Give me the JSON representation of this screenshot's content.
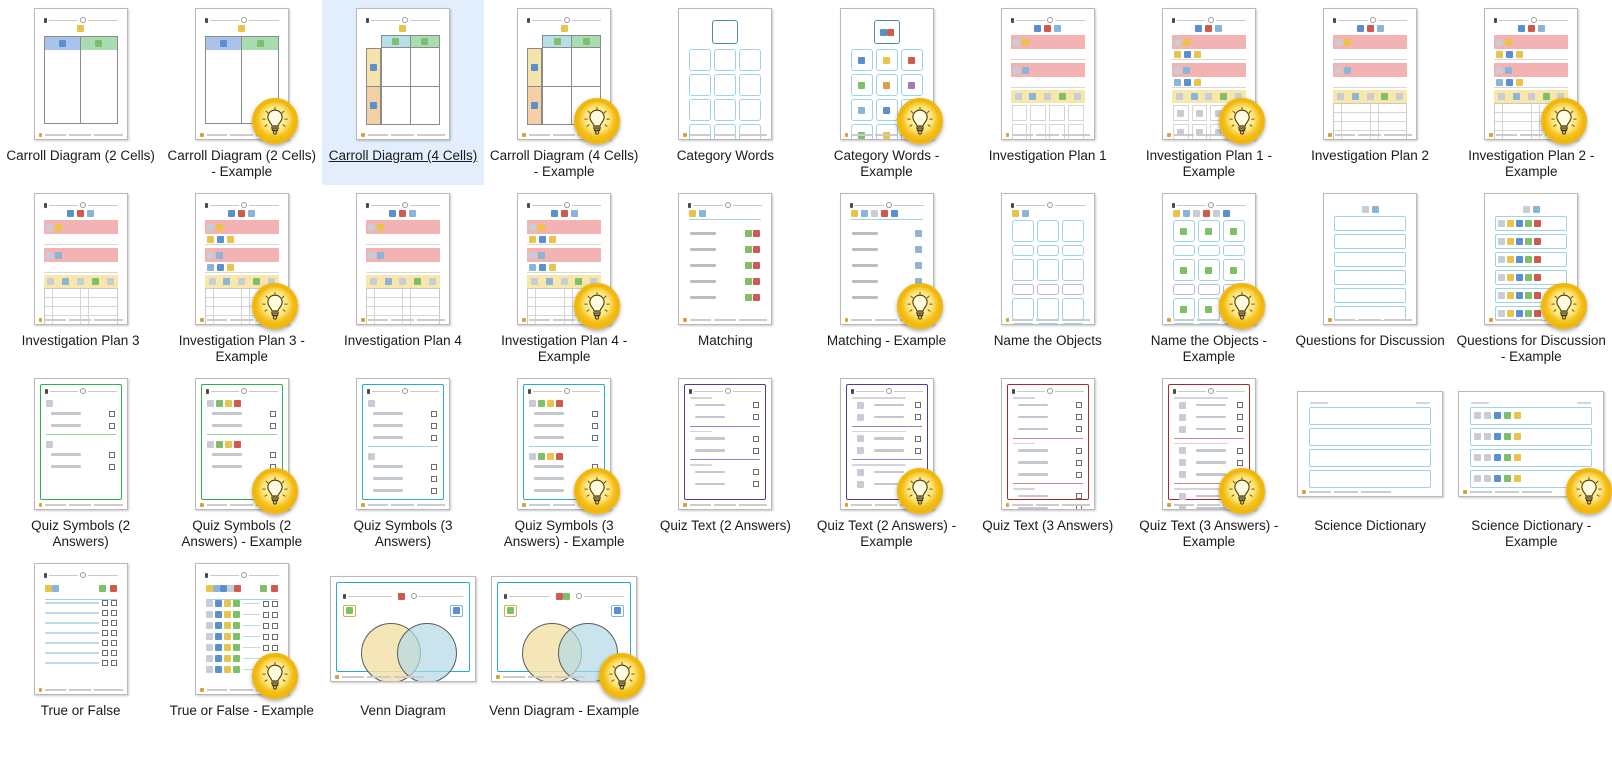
{
  "window": {
    "background": "#ffffff",
    "selection_color": "#e2eefc",
    "badge_color": "#f2b70d"
  },
  "grid": {
    "columns": 10,
    "rows": 4,
    "item_count": 34
  },
  "items": [
    {
      "label": "Carroll Diagram (2 Cells)",
      "kind": "carroll2",
      "example": false,
      "selected": false,
      "orientation": "portrait",
      "border": "none"
    },
    {
      "label": "Carroll Diagram (2 Cells) - Example",
      "kind": "carroll2ex",
      "example": true,
      "selected": false,
      "orientation": "portrait",
      "border": "none"
    },
    {
      "label": "Carroll Diagram (4 Cells)",
      "kind": "carroll4",
      "example": false,
      "selected": true,
      "orientation": "portrait",
      "border": "none"
    },
    {
      "label": "Carroll Diagram (4 Cells) - Example",
      "kind": "carroll4",
      "example": true,
      "selected": false,
      "orientation": "portrait",
      "border": "none"
    },
    {
      "label": "Category Words",
      "kind": "category",
      "example": false,
      "selected": false,
      "orientation": "portrait",
      "border": "none"
    },
    {
      "label": "Category Words - Example",
      "kind": "categoryex",
      "example": true,
      "selected": false,
      "orientation": "portrait",
      "border": "none"
    },
    {
      "label": "Investigation Plan 1",
      "kind": "plan1",
      "example": false,
      "selected": false,
      "orientation": "portrait",
      "border": "none"
    },
    {
      "label": "Investigation Plan 1 - Example",
      "kind": "plan1ex",
      "example": true,
      "selected": false,
      "orientation": "portrait",
      "border": "none"
    },
    {
      "label": "Investigation Plan 2",
      "kind": "plan2",
      "example": false,
      "selected": false,
      "orientation": "portrait",
      "border": "none"
    },
    {
      "label": "Investigation Plan 2 - Example",
      "kind": "plan2ex",
      "example": true,
      "selected": false,
      "orientation": "portrait",
      "border": "none"
    },
    {
      "label": "Investigation Plan 3",
      "kind": "plan2",
      "example": false,
      "selected": false,
      "orientation": "portrait",
      "border": "none"
    },
    {
      "label": "Investigation Plan 3 - Example",
      "kind": "plan2ex",
      "example": true,
      "selected": false,
      "orientation": "portrait",
      "border": "none"
    },
    {
      "label": "Investigation Plan 4",
      "kind": "plan2",
      "example": false,
      "selected": false,
      "orientation": "portrait",
      "border": "none"
    },
    {
      "label": "Investigation Plan 4 - Example",
      "kind": "plan2ex",
      "example": true,
      "selected": false,
      "orientation": "portrait",
      "border": "none"
    },
    {
      "label": "Matching",
      "kind": "matching",
      "example": false,
      "selected": false,
      "orientation": "portrait",
      "border": "none"
    },
    {
      "label": "Matching - Example",
      "kind": "matchingex",
      "example": true,
      "selected": false,
      "orientation": "portrait",
      "border": "none"
    },
    {
      "label": "Name the Objects",
      "kind": "nameobj",
      "example": false,
      "selected": false,
      "orientation": "portrait",
      "border": "none"
    },
    {
      "label": "Name the Objects - Example",
      "kind": "nameobjex",
      "example": true,
      "selected": false,
      "orientation": "portrait",
      "border": "none"
    },
    {
      "label": "Questions for Discussion",
      "kind": "questions",
      "example": false,
      "selected": false,
      "orientation": "portrait",
      "border": "none"
    },
    {
      "label": "Questions for Discussion - Example",
      "kind": "questionsex",
      "example": true,
      "selected": false,
      "orientation": "portrait",
      "border": "none"
    },
    {
      "label": "Quiz Symbols (2 Answers)",
      "kind": "quiz2",
      "example": false,
      "selected": false,
      "orientation": "portrait",
      "border": "#2fb14a"
    },
    {
      "label": "Quiz Symbols (2 Answers) - Example",
      "kind": "quiz2ex",
      "example": true,
      "selected": false,
      "orientation": "portrait",
      "border": "#2fb14a"
    },
    {
      "label": "Quiz Symbols (3 Answers)",
      "kind": "quiz3",
      "example": false,
      "selected": false,
      "orientation": "portrait",
      "border": "#29a8d0"
    },
    {
      "label": "Quiz Symbols (3 Answers) - Example",
      "kind": "quiz3ex",
      "example": true,
      "selected": false,
      "orientation": "portrait",
      "border": "#29a8d0"
    },
    {
      "label": "Quiz Text (2 Answers)",
      "kind": "quiztext2",
      "example": false,
      "selected": false,
      "orientation": "portrait",
      "border": "#4b3f9e"
    },
    {
      "label": "Quiz Text (2 Answers) - Example",
      "kind": "quiztext2ex",
      "example": true,
      "selected": false,
      "orientation": "portrait",
      "border": "#4b3f9e"
    },
    {
      "label": "Quiz Text (3 Answers)",
      "kind": "quiztext3",
      "example": false,
      "selected": false,
      "orientation": "portrait",
      "border": "#a32b32"
    },
    {
      "label": "Quiz Text (3 Answers) - Example",
      "kind": "quiztext3ex",
      "example": true,
      "selected": false,
      "orientation": "portrait",
      "border": "#a32b32"
    },
    {
      "label": "Science Dictionary",
      "kind": "dict",
      "example": false,
      "selected": false,
      "orientation": "landscape",
      "border": "none"
    },
    {
      "label": "Science Dictionary - Example",
      "kind": "dictex",
      "example": true,
      "selected": false,
      "orientation": "landscape",
      "border": "none"
    },
    {
      "label": "True or False",
      "kind": "truefalse",
      "example": false,
      "selected": false,
      "orientation": "portrait",
      "border": "none"
    },
    {
      "label": "True or False - Example",
      "kind": "truefalseex",
      "example": true,
      "selected": false,
      "orientation": "portrait",
      "border": "none"
    },
    {
      "label": "Venn Diagram",
      "kind": "venn",
      "example": false,
      "selected": false,
      "orientation": "landscape",
      "border": "#29a8d0"
    },
    {
      "label": "Venn Diagram - Example",
      "kind": "vennex",
      "example": true,
      "selected": false,
      "orientation": "landscape",
      "border": "#29a8d0"
    }
  ],
  "icons": {
    "example_badge": "lightbulb-icon"
  }
}
